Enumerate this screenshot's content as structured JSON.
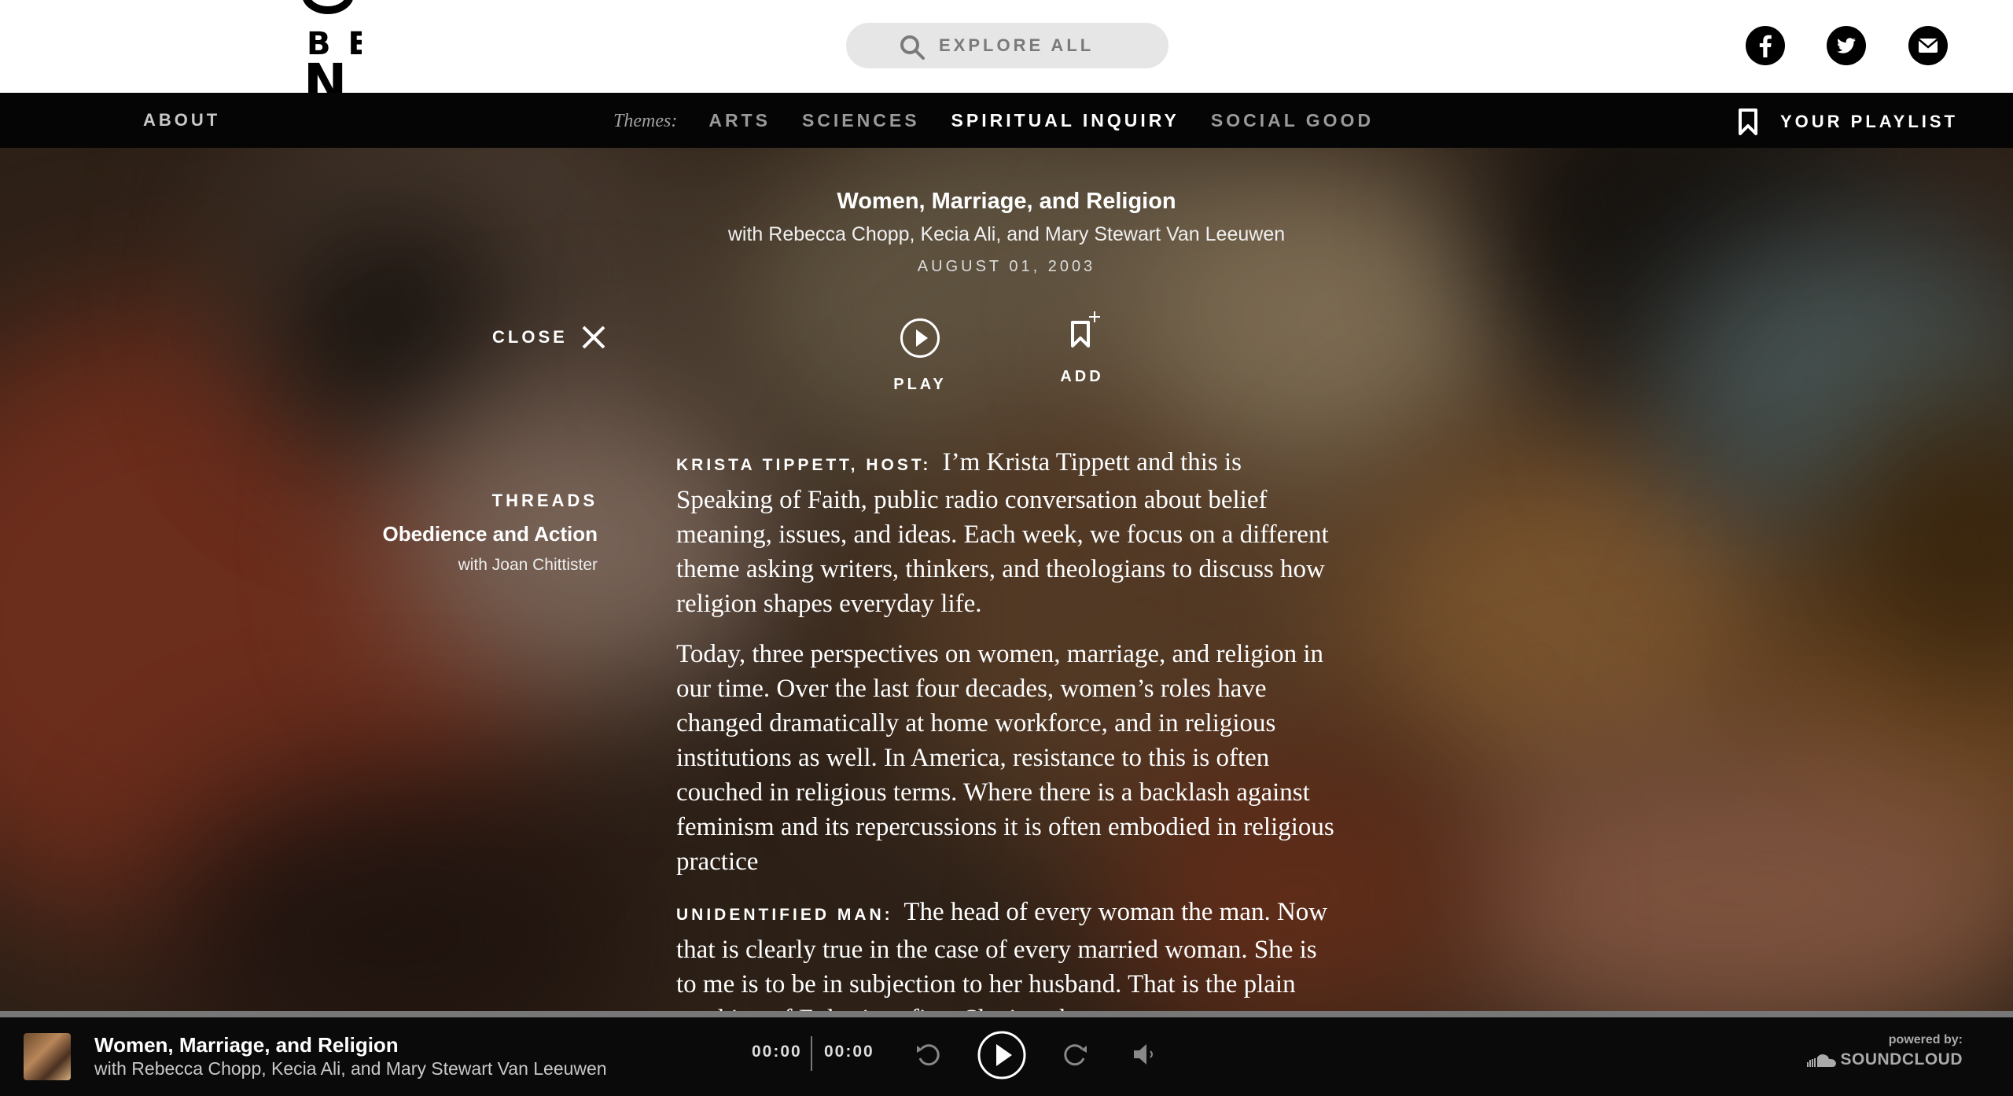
{
  "header": {
    "logo_letters": "BE",
    "logo_last_letter": "N",
    "search_placeholder": "EXPLORE ALL",
    "social": [
      "facebook-icon",
      "twitter-icon",
      "mail-icon"
    ]
  },
  "nav": {
    "about": "ABOUT",
    "themes_label": "Themes:",
    "themes": [
      "ARTS",
      "SCIENCES",
      "SPIRITUAL INQUIRY",
      "SOCIAL GOOD"
    ],
    "active_theme": "SPIRITUAL INQUIRY",
    "playlist": "YOUR PLAYLIST"
  },
  "episode": {
    "title": "Women, Marriage, and Religion",
    "guests": "with Rebecca Chopp, Kecia Ali, and Mary Stewart Van Leeuwen",
    "date": "AUGUST 01, 2003"
  },
  "actions": {
    "close": "CLOSE",
    "play": "PLAY",
    "add": "ADD"
  },
  "threads": {
    "heading": "THREADS",
    "title": "Obedience and Action",
    "with": "with Joan Chittister"
  },
  "transcript": {
    "p1_speaker": "KRISTA TIPPETT, HOST:",
    "p1_text": "I’m Krista Tippett and this is Speaking of Faith, public radio conversation about belief meaning, issues, and ideas. Each week, we focus on a different theme asking writers, thinkers, and theologians to discuss how religion shapes everyday life.",
    "p2_text": "Today, three perspectives on women, marriage, and religion in our time. Over the last four decades, women’s roles have changed dramatically at home workforce, and in religious institutions as well. In America, resistance to this is often couched in religious terms. Where there is a backlash against feminism and its repercussions it is often embodied in religious practice",
    "p3_speaker": "UNIDENTIFIED MAN:",
    "p3_text": "The head of every woman the man. Now that is clearly true in the case of every married woman. She is to me is to be in subjection to her husband. That is the plain teaching of Ephesians five. She is to be"
  },
  "player": {
    "title": "Women, Marriage, and Religion",
    "guests": "with Rebecca Chopp, Kecia Ali, and Mary Stewart Van Leeuwen",
    "current_time": "00:00",
    "total_time": "00:00",
    "progress": 0,
    "powered_by": "powered by:",
    "provider": "SOUNDCLOUD"
  },
  "colors": {
    "header_bg": "#ffffff",
    "nav_bg": "#050505",
    "player_bg": "#0a0a0a",
    "search_bg": "#e6e6e6"
  }
}
